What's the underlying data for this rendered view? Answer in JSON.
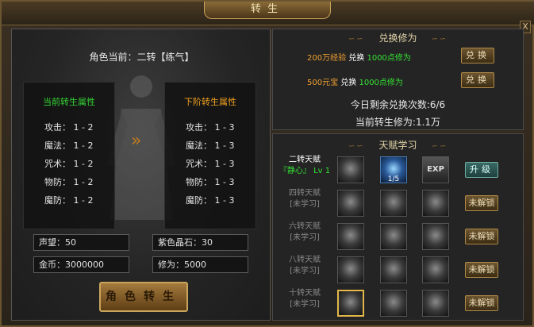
{
  "window": {
    "title": "转生",
    "close": "X"
  },
  "left": {
    "current_label": "角色当前：二转【练气】",
    "current_attrs": {
      "title": "当前转生属性",
      "rows": [
        "攻击： 1 - 2",
        "魔法： 1 - 2",
        "咒术： 1 - 2",
        "物防： 1 - 2",
        "魔防： 1 - 2"
      ]
    },
    "next_attrs": {
      "title": "下阶转生属性",
      "rows": [
        "攻击： 1 - 3",
        "魔法： 1 - 3",
        "咒术： 1 - 3",
        "物防： 1 - 3",
        "魔防： 1 - 3"
      ]
    },
    "arrow": "»",
    "stats": {
      "prestige": "声望：50",
      "purple_crystal": "紫色晶石：30",
      "gold": "金币：3000000",
      "cultivation": "修为：5000"
    },
    "rebirth_button": "角色转生"
  },
  "exchange": {
    "header": "兑换修为",
    "deco": "∽∽",
    "rows": [
      {
        "cost": "200万经验",
        "verb": "兑换",
        "gain": "1000点修为",
        "button": "兑换"
      },
      {
        "cost": "500元宝",
        "verb": "兑换",
        "gain": "1000点修为",
        "button": "兑换"
      }
    ],
    "remaining": "今日剩余兑换次数:6/6",
    "current": "当前转生修为:1.1万"
  },
  "talent": {
    "header": "天赋学习",
    "rows": [
      {
        "name": "二转天赋",
        "status": "『静心』 Lv 1",
        "button": "升级",
        "active": true
      },
      {
        "name": "四转天赋",
        "status": "[未学习]",
        "button": "未解锁",
        "active": false
      },
      {
        "name": "六转天赋",
        "status": "[未学习]",
        "button": "未解锁",
        "active": false
      },
      {
        "name": "八转天赋",
        "status": "[未学习]",
        "button": "未解锁",
        "active": false
      },
      {
        "name": "十转天赋",
        "status": "[未学习]",
        "button": "未解锁",
        "active": false
      }
    ],
    "first_skill_count": "1/5",
    "exp_label": "EXP"
  },
  "colors": {
    "gold_border": "#c9a45a",
    "green": "#33e033",
    "orange": "#f0a030"
  }
}
